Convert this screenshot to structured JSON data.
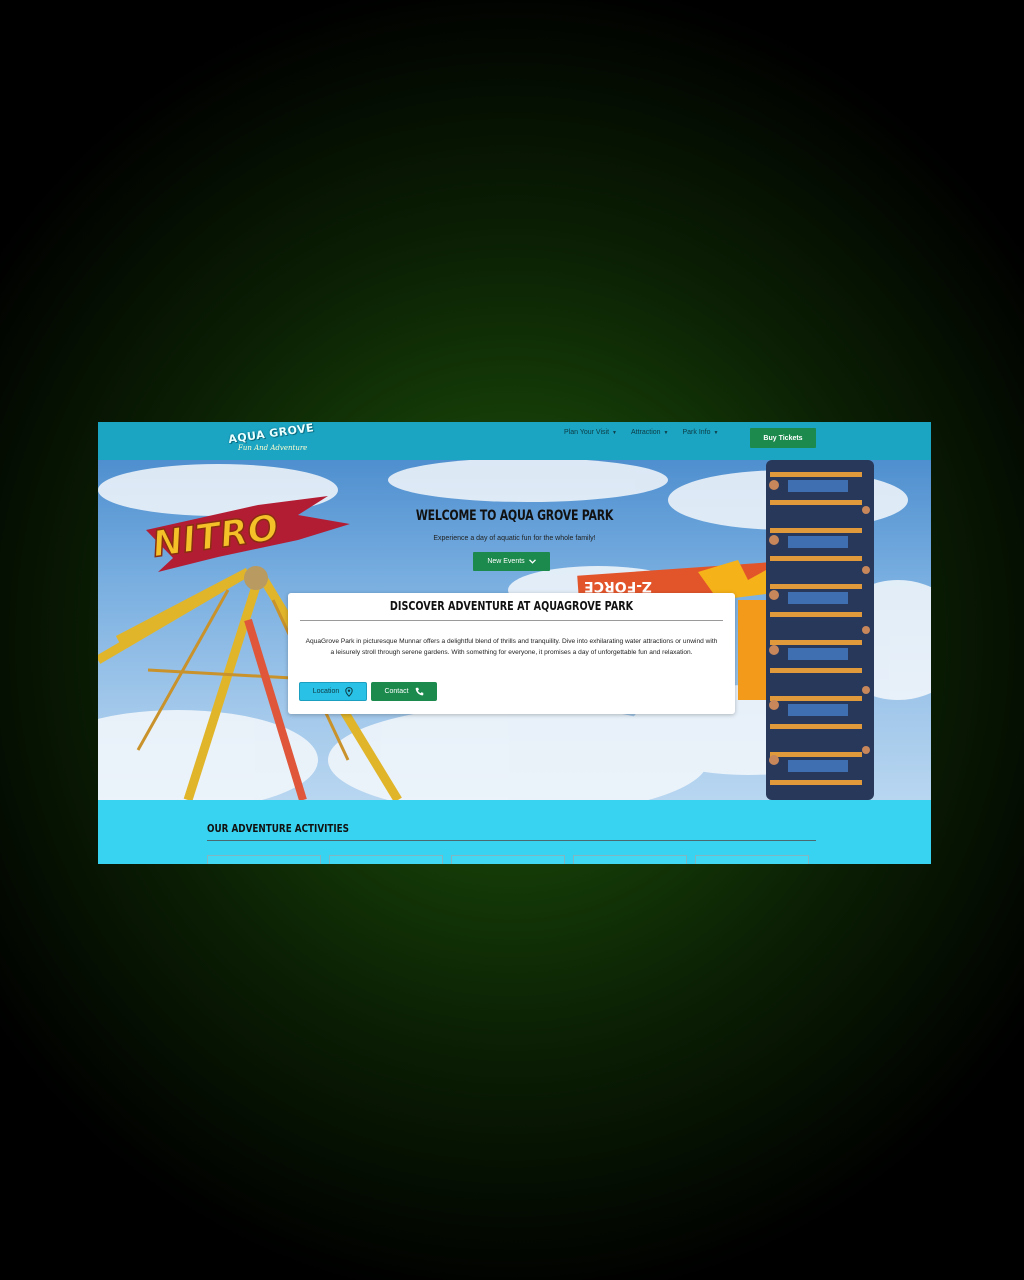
{
  "header": {
    "logo_title": "AQUA GROVE",
    "logo_tagline": "Fun And Adventure",
    "nav": [
      {
        "label": "Plan Your Visit"
      },
      {
        "label": "Attraction"
      },
      {
        "label": "Park Info"
      }
    ],
    "buy_label": "Buy Tickets"
  },
  "hero": {
    "title": "WELCOME TO AQUA GROVE PARK",
    "subtitle": "Experience a day of aquatic fun for the whole family!",
    "events_label": "New Events",
    "ride_sign": "NITRO",
    "ride_logo": "Z-FORCE"
  },
  "card": {
    "title": "DISCOVER ADVENTURE AT AQUAGROVE PARK",
    "body": "AquaGrove Park in picturesque Munnar offers a delightful blend of thrills and tranquility. Dive into exhilarating water attractions or unwind with a leisurely stroll through serene gardens. With something for everyone, it promises a day of unforgettable fun and relaxation.",
    "location_label": "Location",
    "contact_label": "Contact"
  },
  "activities": {
    "title": "OUR ADVENTURE ACTIVITIES",
    "card_count": 5
  },
  "colors": {
    "navbar": "#1ba5c2",
    "primary_green": "#1c8a4d",
    "accent_cyan": "#38d3f0"
  }
}
